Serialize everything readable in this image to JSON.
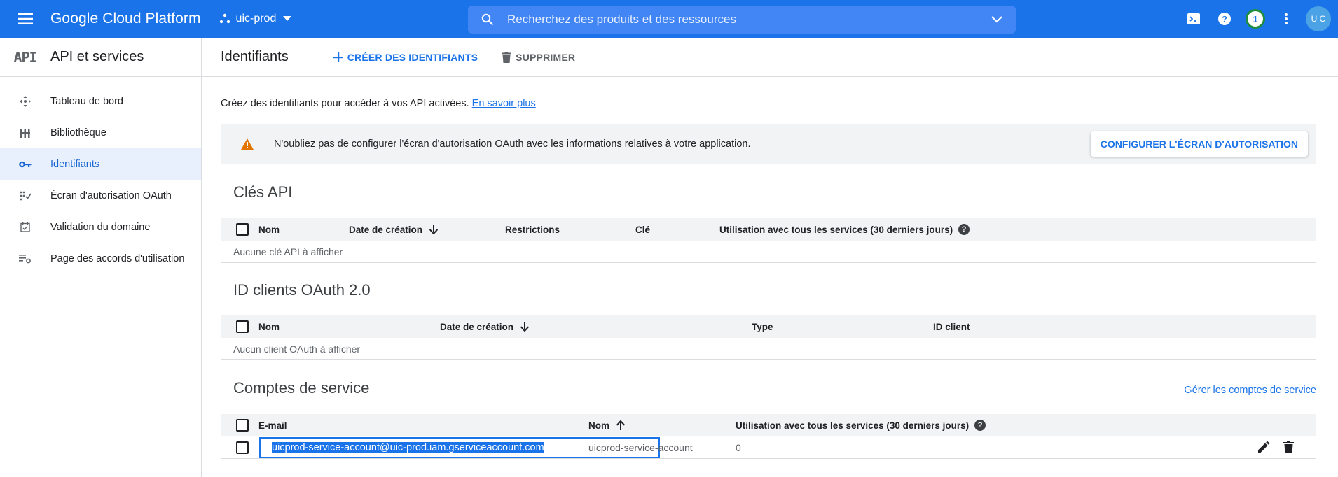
{
  "topbar": {
    "brand": "Google Cloud Platform",
    "project": "uic-prod",
    "search_placeholder": "Recherchez des produits et des ressources",
    "notification_count": "1",
    "avatar_text": "U C",
    "accent": "#1a73e8"
  },
  "sidebar": {
    "logo": "API",
    "title": "API et services",
    "items": [
      {
        "label": "Tableau de bord",
        "icon": "dashboard-icon"
      },
      {
        "label": "Bibliothèque",
        "icon": "library-icon"
      },
      {
        "label": "Identifiants",
        "icon": "key-icon",
        "active": true
      },
      {
        "label": "Écran d'autorisation OAuth",
        "icon": "oauth-consent-icon"
      },
      {
        "label": "Validation du domaine",
        "icon": "domain-check-icon"
      },
      {
        "label": "Page des accords d'utilisation",
        "icon": "agreements-icon"
      }
    ]
  },
  "actionbar": {
    "title": "Identifiants",
    "create_label": "CRÉER DES IDENTIFIANTS",
    "delete_label": "SUPPRIMER"
  },
  "intro": {
    "text": "Créez des identifiants pour accéder à vos API activées.",
    "link": "En savoir plus"
  },
  "banner": {
    "text": "N'oubliez pas de configurer l'écran d'autorisation OAuth avec les informations relatives à votre application.",
    "button": "CONFIGURER L'ÉCRAN D'AUTORISATION"
  },
  "api_keys": {
    "title": "Clés API",
    "columns": [
      "Nom",
      "Date de création",
      "Restrictions",
      "Clé",
      "Utilisation avec tous les services (30 derniers jours)"
    ],
    "empty": "Aucune clé API à afficher"
  },
  "oauth_clients": {
    "title": "ID clients OAuth 2.0",
    "columns": [
      "Nom",
      "Date de création",
      "Type",
      "ID client"
    ],
    "empty": "Aucun client OAuth à afficher"
  },
  "service_accounts": {
    "title": "Comptes de service",
    "manage_link": "Gérer les comptes de service",
    "columns": [
      "E-mail",
      "Nom",
      "Utilisation avec tous les services (30 derniers jours)"
    ],
    "rows": [
      {
        "email": "uicprod-service-account@uic-prod.iam.gserviceaccount.com",
        "name": "uicprod-service-account",
        "usage": "0"
      }
    ]
  }
}
